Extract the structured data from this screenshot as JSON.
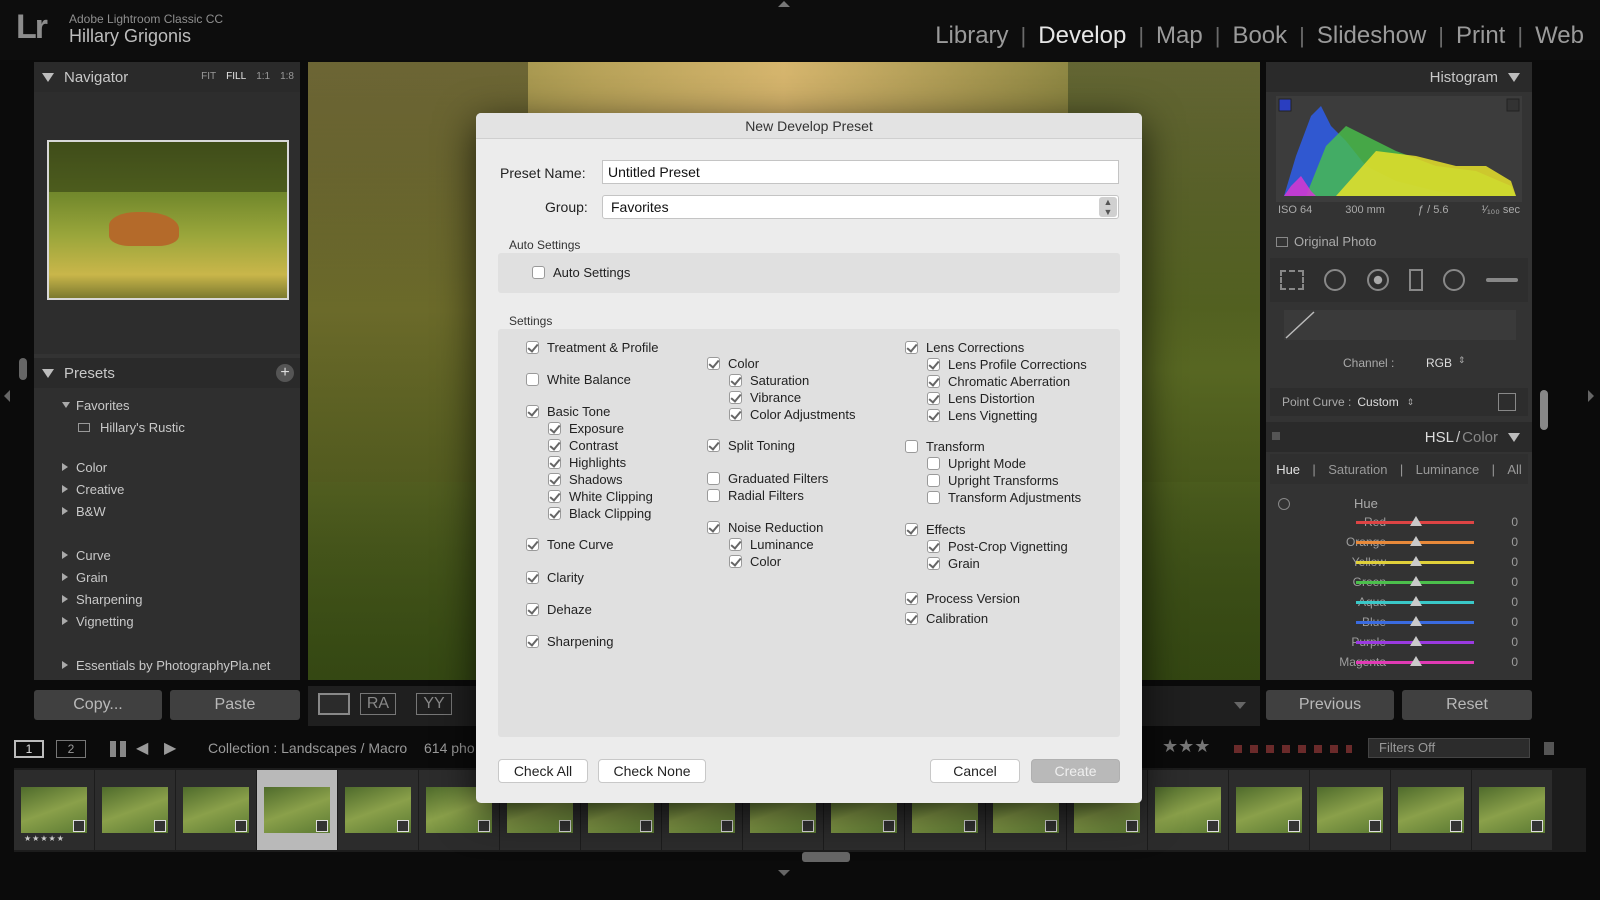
{
  "app": {
    "logo": "Lr",
    "name": "Adobe Lightroom Classic CC",
    "user": "Hillary Grigonis"
  },
  "modules": [
    "Library",
    "Develop",
    "Map",
    "Book",
    "Slideshow",
    "Print",
    "Web"
  ],
  "active_module": "Develop",
  "navigator": {
    "title": "Navigator",
    "zoom": [
      "FIT",
      "FILL",
      "1:1",
      "1:8"
    ],
    "zoom_active": "FILL"
  },
  "presets": {
    "title": "Presets",
    "favorites": {
      "label": "Favorites",
      "item": "Hillary's Rustic"
    },
    "groups1": [
      "Color",
      "Creative",
      "B&W"
    ],
    "groups2": [
      "Curve",
      "Grain",
      "Sharpening",
      "Vignetting"
    ],
    "groups3": [
      "Essentials by PhotographyPla.net"
    ]
  },
  "left_buttons": {
    "copy": "Copy...",
    "paste": "Paste"
  },
  "toolbar": {
    "ra": "RA",
    "yy": "YY"
  },
  "histogram": {
    "title": "Histogram",
    "iso": "ISO 64",
    "focal": "300 mm",
    "aperture": "ƒ / 5.6",
    "shutter": "¹⁄₁₀₀ sec",
    "original_photo": "Original Photo"
  },
  "tone_curve": {
    "channel_label": "Channel :",
    "channel_value": "RGB",
    "point_curve_label": "Point Curve :",
    "point_curve_value": "Custom"
  },
  "hsl": {
    "title_hsl": "HSL",
    "title_sep": "/",
    "title_color": "Color",
    "tabs": [
      "Hue",
      "Saturation",
      "Luminance",
      "All"
    ],
    "active_tab": "Hue",
    "section": "Hue",
    "rows": [
      {
        "label": "Red",
        "value": "0",
        "color": "#d44"
      },
      {
        "label": "Orange",
        "value": "0",
        "color": "#e8893a"
      },
      {
        "label": "Yellow",
        "value": "0",
        "color": "#e0d03a"
      },
      {
        "label": "Green",
        "value": "0",
        "color": "#4cbf4c"
      },
      {
        "label": "Aqua",
        "value": "0",
        "color": "#3ac8c8"
      },
      {
        "label": "Blue",
        "value": "0",
        "color": "#3a6be0"
      },
      {
        "label": "Purple",
        "value": "0",
        "color": "#9a3ae0"
      },
      {
        "label": "Magenta",
        "value": "0",
        "color": "#e03ab4"
      }
    ]
  },
  "right_buttons": {
    "previous": "Previous",
    "reset": "Reset"
  },
  "filmbar": {
    "page1": "1",
    "page2": "2",
    "collection": "Collection : Landscapes / Macro",
    "count": "614 pho",
    "filters": "Filters Off"
  },
  "filmstrip": {
    "rating": "★★★★★"
  },
  "dialog": {
    "title": "New Develop Preset",
    "preset_name_label": "Preset Name:",
    "preset_name_value": "Untitled Preset",
    "group_label": "Group:",
    "group_value": "Favorites",
    "auto_section": "Auto Settings",
    "auto_checkbox": "Auto Settings",
    "settings_section": "Settings",
    "col1": {
      "treatment": "Treatment & Profile",
      "white_balance": "White Balance",
      "basic_tone": "Basic Tone",
      "exposure": "Exposure",
      "contrast": "Contrast",
      "highlights": "Highlights",
      "shadows": "Shadows",
      "white_clipping": "White Clipping",
      "black_clipping": "Black Clipping",
      "tone_curve": "Tone Curve",
      "clarity": "Clarity",
      "dehaze": "Dehaze",
      "sharpening": "Sharpening"
    },
    "col2": {
      "color": "Color",
      "saturation": "Saturation",
      "vibrance": "Vibrance",
      "color_adjustments": "Color Adjustments",
      "split_toning": "Split Toning",
      "graduated_filters": "Graduated Filters",
      "radial_filters": "Radial Filters",
      "noise_reduction": "Noise Reduction",
      "luminance": "Luminance",
      "nr_color": "Color"
    },
    "col3": {
      "lens_corrections": "Lens Corrections",
      "lens_profile": "Lens Profile Corrections",
      "chromatic": "Chromatic Aberration",
      "lens_distortion": "Lens Distortion",
      "lens_vignetting": "Lens Vignetting",
      "transform": "Transform",
      "upright_mode": "Upright Mode",
      "upright_transforms": "Upright Transforms",
      "transform_adjustments": "Transform Adjustments",
      "effects": "Effects",
      "post_crop": "Post-Crop Vignetting",
      "grain": "Grain",
      "process_version": "Process Version",
      "calibration": "Calibration"
    },
    "buttons": {
      "check_all": "Check All",
      "check_none": "Check None",
      "cancel": "Cancel",
      "create": "Create"
    }
  }
}
